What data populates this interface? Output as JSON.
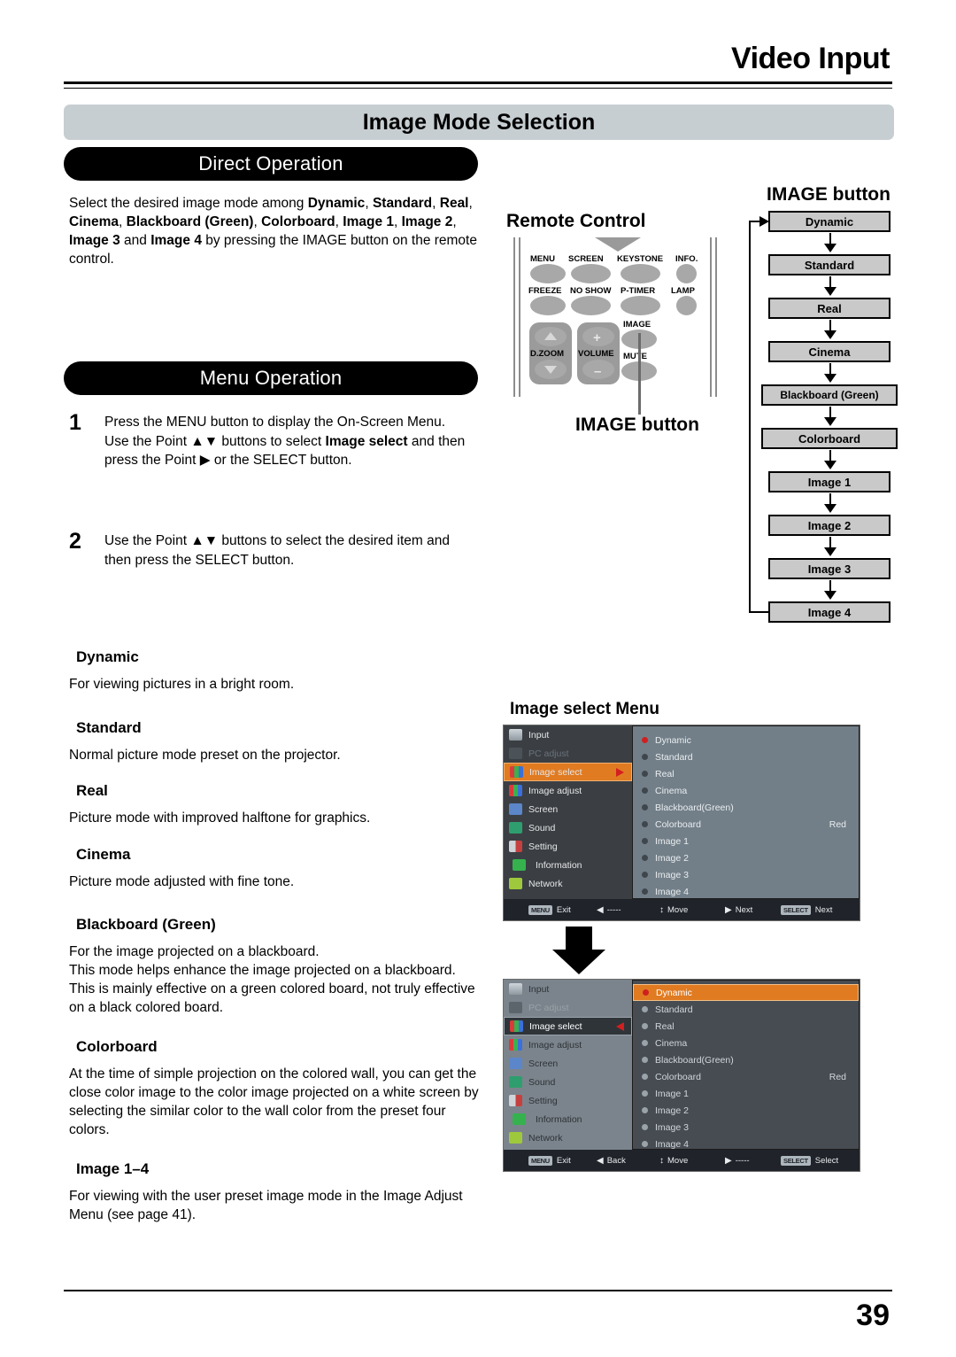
{
  "header": {
    "title": "Video Input"
  },
  "section": {
    "title": "Image Mode Selection"
  },
  "direct": {
    "pill": "Direct Operation",
    "paragraph_p1": "Select the desired image mode among ",
    "b1": "Dynamic",
    "p2": ", ",
    "b2": "Standard",
    "p3": ", ",
    "b3": "Real",
    "p4": ", ",
    "b4": "Cinema",
    "p5": ", ",
    "b5": "Blackboard (Green)",
    "p6": ", ",
    "b6": "Colorboard",
    "p7": ", ",
    "b7": "Image 1",
    "p8": ", ",
    "b8": "Image 2",
    "p9": ", ",
    "b9": "Image 3",
    "p10": " and ",
    "b10": "Image 4",
    "p11": " by pressing the IMAGE button on the remote control."
  },
  "menu_op": {
    "pill": "Menu Operation",
    "step1_num": "1",
    "step1_a": "Press the MENU button to display the On-Screen Menu. Use the Point ▲▼ buttons to select ",
    "step1_b": "Image select",
    "step1_c": " and then press the Point ▶ or the SELECT button.",
    "step2_num": "2",
    "step2_a": "Use the Point ▲▼ buttons to select  the desired item and then press the SELECT button."
  },
  "modes": [
    {
      "name": "Dynamic",
      "desc": "For viewing pictures in a bright room."
    },
    {
      "name": "Standard",
      "desc": "Normal picture mode preset on the projector."
    },
    {
      "name": "Real",
      "desc": "Picture mode with improved halftone for graphics."
    },
    {
      "name": "Cinema",
      "desc": "Picture mode adjusted with fine tone."
    },
    {
      "name": "Blackboard (Green)",
      "desc": "For the image projected on a blackboard.\nThis mode helps enhance the image projected on a blackboard. This is mainly effective on a green colored board, not truly effective on a black colored board."
    },
    {
      "name": "Colorboard",
      "desc": "At the time of simple projection on the colored wall, you can get the close color image to the color image projected on a white screen by selecting the similar color to the wall color from the preset four colors."
    },
    {
      "name": "Image 1–4",
      "desc": "For viewing with the user preset image mode in the Image Adjust Menu (see page 41)."
    }
  ],
  "remote": {
    "title": "Remote Control",
    "callout": "IMAGE button",
    "buttons": {
      "menu": "MENU",
      "screen": "SCREEN",
      "keystone": "KEYSTONE",
      "info": "INFO.",
      "freeze": "FREEZE",
      "no_show": "NO SHOW",
      "p_timer": "P-TIMER",
      "lamp": "LAMP",
      "d_zoom": "D.ZOOM",
      "volume": "VOLUME",
      "image": "IMAGE",
      "mute": "MUTE",
      "plus": "+",
      "minus": "–"
    }
  },
  "flow": {
    "title": "IMAGE button",
    "items": [
      "Dynamic",
      "Standard",
      "Real",
      "Cinema",
      "Blackboard (Green)",
      "Colorboard",
      "Image 1",
      "Image 2",
      "Image 3",
      "Image 4"
    ]
  },
  "osd": {
    "label": "Image select Menu",
    "sidebar": [
      {
        "label": "Input",
        "state": "normal"
      },
      {
        "label": "PC adjust",
        "state": "dim"
      },
      {
        "label": "Image select",
        "state": "selected"
      },
      {
        "label": "Image adjust",
        "state": "normal"
      },
      {
        "label": "Screen",
        "state": "normal"
      },
      {
        "label": "Sound",
        "state": "normal"
      },
      {
        "label": "Setting",
        "state": "normal"
      },
      {
        "label": "Information",
        "state": "normal"
      },
      {
        "label": "Network",
        "state": "normal"
      }
    ],
    "options": [
      {
        "label": "Dynamic",
        "value": ""
      },
      {
        "label": "Standard",
        "value": ""
      },
      {
        "label": "Real",
        "value": ""
      },
      {
        "label": "Cinema",
        "value": ""
      },
      {
        "label": "Blackboard(Green)",
        "value": ""
      },
      {
        "label": "Colorboard",
        "value": "Red"
      },
      {
        "label": "Image 1",
        "value": ""
      },
      {
        "label": "Image 2",
        "value": ""
      },
      {
        "label": "Image 3",
        "value": ""
      },
      {
        "label": "Image 4",
        "value": ""
      }
    ],
    "status1": [
      {
        "chip": "MENU",
        "glyph": "",
        "text": "Exit"
      },
      {
        "chip": "",
        "glyph": "◀",
        "text": "-----"
      },
      {
        "chip": "",
        "glyph": "↕",
        "text": "Move"
      },
      {
        "chip": "",
        "glyph": "▶",
        "text": "Next"
      },
      {
        "chip": "SELECT",
        "glyph": "",
        "text": "Next"
      }
    ],
    "status2": [
      {
        "chip": "MENU",
        "glyph": "",
        "text": "Exit"
      },
      {
        "chip": "",
        "glyph": "◀",
        "text": "Back"
      },
      {
        "chip": "",
        "glyph": "↕",
        "text": "Move"
      },
      {
        "chip": "",
        "glyph": "▶",
        "text": "-----"
      },
      {
        "chip": "SELECT",
        "glyph": "",
        "text": "Select"
      }
    ]
  },
  "footer": {
    "page_number": "39"
  },
  "colors": {
    "section_bar": "#c7ced2",
    "pill": "#000000",
    "flow_box": "#c9c9c9",
    "osd_highlight": "#e07b22",
    "osd_marker_red": "#cf2020"
  }
}
